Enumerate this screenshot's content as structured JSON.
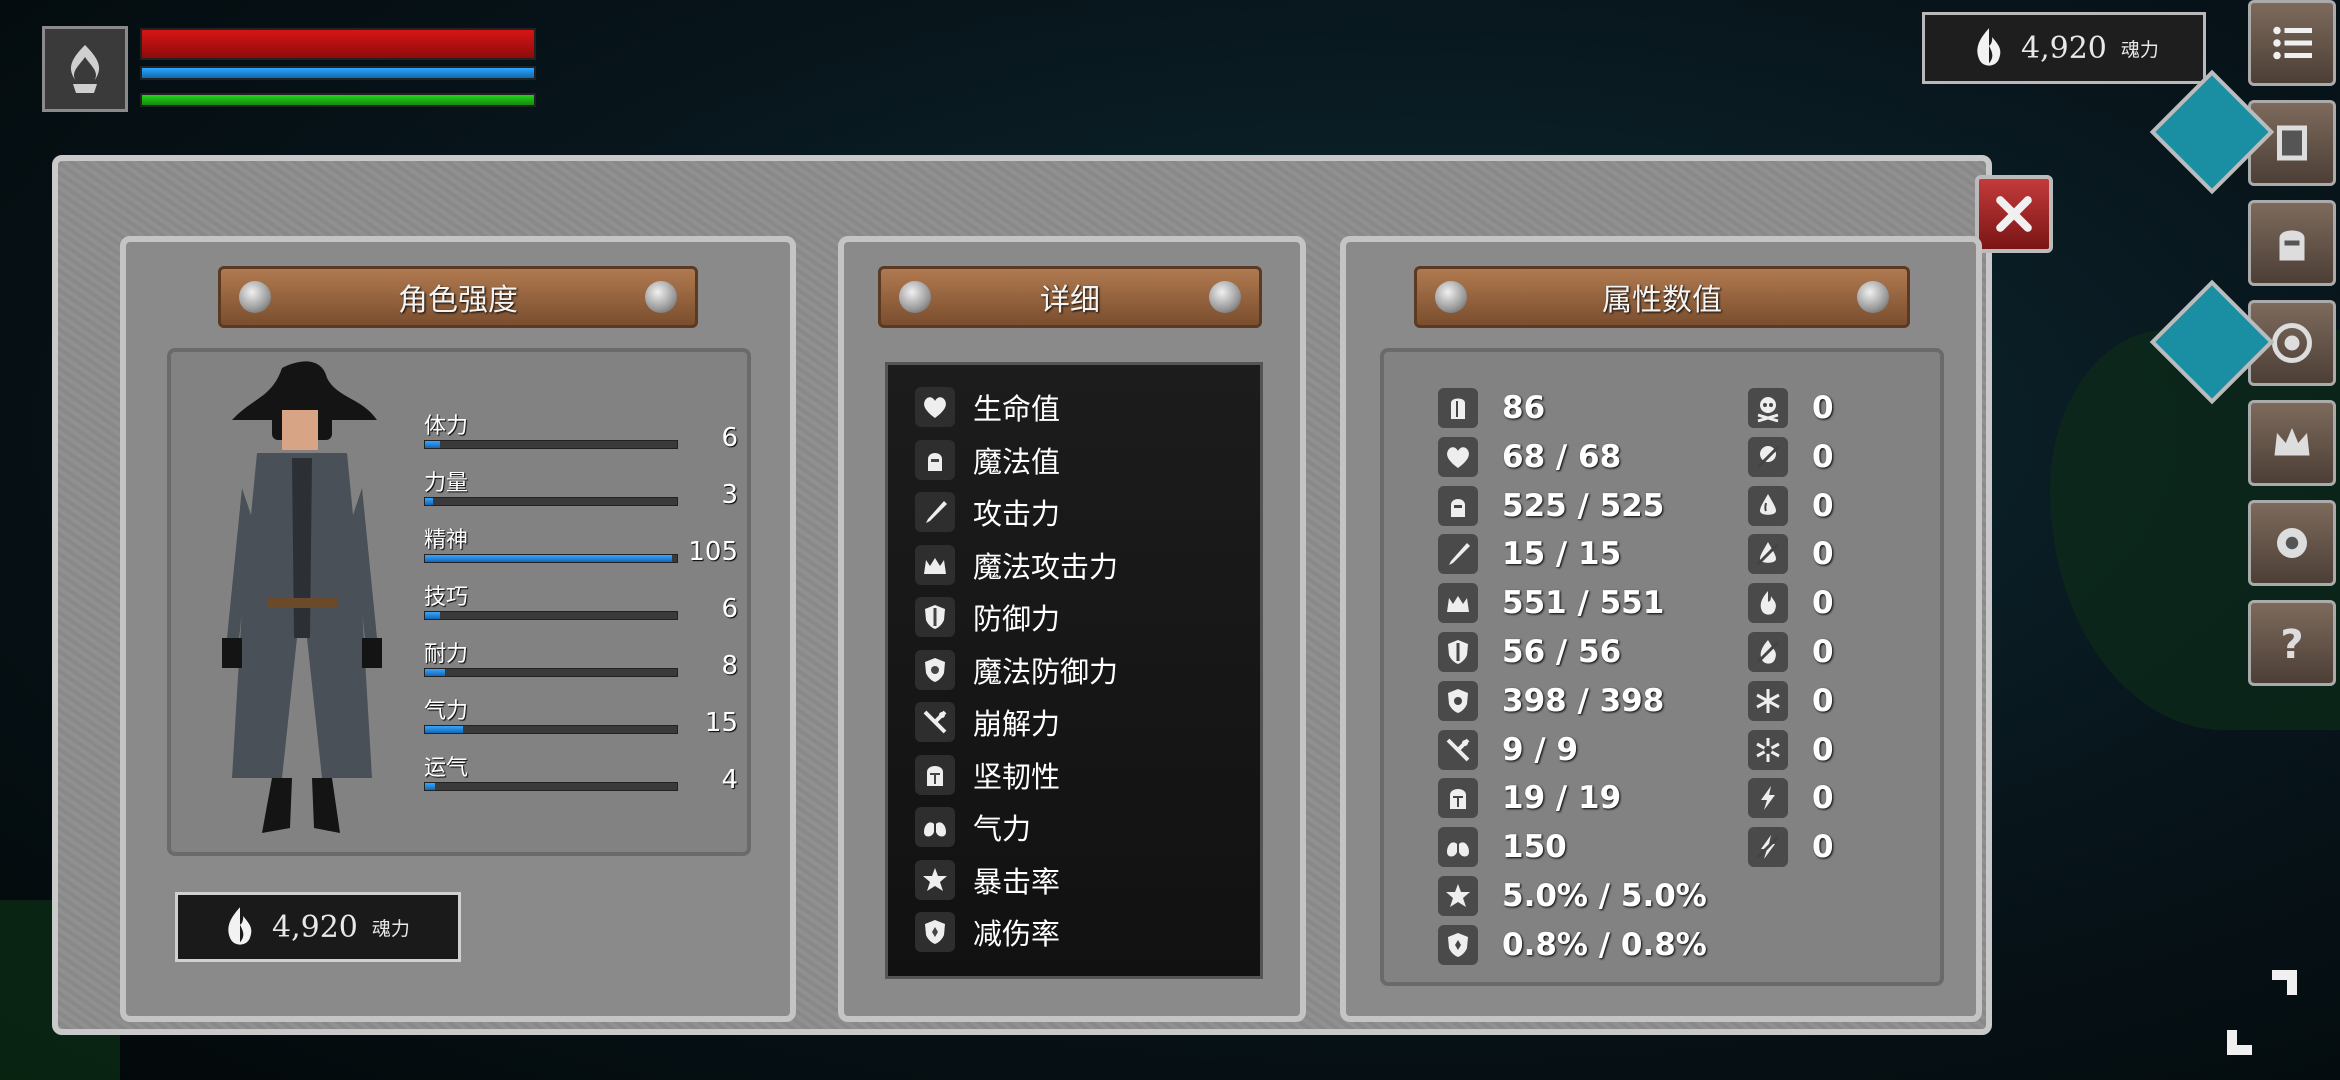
{
  "hud": {
    "soul_value": "4,920",
    "soul_unit": "魂力"
  },
  "toolbar": [
    "menu-icon",
    "map-icon",
    "helmet-icon",
    "emblem-icon",
    "crown-icon",
    "gear-icon",
    "question-icon"
  ],
  "panels": {
    "strength": {
      "title": "角色强度",
      "stats": [
        {
          "label": "体力",
          "value": "6",
          "fill": 0.06
        },
        {
          "label": "力量",
          "value": "3",
          "fill": 0.03
        },
        {
          "label": "精神",
          "value": "105",
          "fill": 0.98
        },
        {
          "label": "技巧",
          "value": "6",
          "fill": 0.06
        },
        {
          "label": "耐力",
          "value": "8",
          "fill": 0.08
        },
        {
          "label": "气力",
          "value": "15",
          "fill": 0.15
        },
        {
          "label": "运气",
          "value": "4",
          "fill": 0.04
        }
      ],
      "soul_value": "4,920",
      "soul_unit": "魂力"
    },
    "detail": {
      "title": "详细",
      "items": [
        {
          "label": "生命值",
          "icon": "heart-icon"
        },
        {
          "label": "魔法值",
          "icon": "head-icon"
        },
        {
          "label": "攻击力",
          "icon": "sword-icon"
        },
        {
          "label": "魔法攻击力",
          "icon": "magic-crown-icon"
        },
        {
          "label": "防御力",
          "icon": "shield-icon"
        },
        {
          "label": "魔法防御力",
          "icon": "magic-shield-icon"
        },
        {
          "label": "崩解力",
          "icon": "break-icon"
        },
        {
          "label": "坚韧性",
          "icon": "helm-icon"
        },
        {
          "label": "气力",
          "icon": "lungs-icon"
        },
        {
          "label": "暴击率",
          "icon": "star-icon"
        },
        {
          "label": "减伤率",
          "icon": "reduce-icon"
        }
      ]
    },
    "attributes": {
      "title": "属性数值",
      "left": [
        {
          "icon": "armor-icon",
          "value": "86"
        },
        {
          "icon": "heart-icon",
          "value": "68 / 68"
        },
        {
          "icon": "head-icon",
          "value": "525 / 525"
        },
        {
          "icon": "sword-icon",
          "value": "15 / 15"
        },
        {
          "icon": "magic-crown-icon",
          "value": "551 / 551"
        },
        {
          "icon": "shield-icon",
          "value": "56 / 56"
        },
        {
          "icon": "magic-shield-icon",
          "value": "398 / 398"
        },
        {
          "icon": "break-icon",
          "value": "9 / 9"
        },
        {
          "icon": "helm-icon",
          "value": "19 / 19"
        },
        {
          "icon": "lungs-icon",
          "value": "150"
        },
        {
          "icon": "star-icon",
          "value": "5.0% / 5.0%"
        },
        {
          "icon": "reduce-icon",
          "value": "0.8% / 0.8%"
        }
      ],
      "right": [
        {
          "icon": "poison-skull-icon",
          "value": "0"
        },
        {
          "icon": "poison-resist-icon",
          "value": "0"
        },
        {
          "icon": "bleed-icon",
          "value": "0"
        },
        {
          "icon": "bleed-resist-icon",
          "value": "0"
        },
        {
          "icon": "fire-icon",
          "value": "0"
        },
        {
          "icon": "fire-resist-icon",
          "value": "0"
        },
        {
          "icon": "frost-icon",
          "value": "0"
        },
        {
          "icon": "frost-resist-icon",
          "value": "0"
        },
        {
          "icon": "lightning-icon",
          "value": "0"
        },
        {
          "icon": "lightning-resist-icon",
          "value": "0"
        }
      ]
    }
  },
  "colors": {
    "hp": "#d61515",
    "mp": "#2ca6ff",
    "stamina": "#23d31b",
    "stat_fill": "#2a8ee0"
  }
}
